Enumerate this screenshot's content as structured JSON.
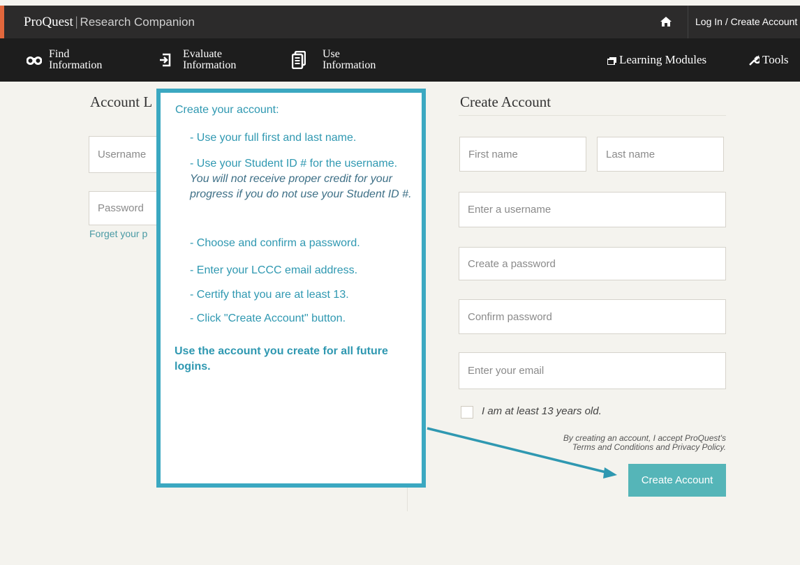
{
  "header": {
    "brand": "ProQuest",
    "brand_separator": "|",
    "product": "Research Companion",
    "login_label": "Log In / Create Account",
    "colors": {
      "accent_strip": "#e2673c",
      "top_bar": "#2c2b2b"
    }
  },
  "nav": {
    "items": [
      {
        "line1": "Find",
        "line2": "Information",
        "icon": "binoculars-icon"
      },
      {
        "line1": "Evaluate",
        "line2": "Information",
        "icon": "sign-in-icon"
      },
      {
        "line1": "Use",
        "line2": "Information",
        "icon": "document-icon"
      }
    ],
    "learning_modules_label": "Learning Modules",
    "tools_label": "Tools"
  },
  "login": {
    "title": "Account L",
    "username_placeholder": "Username",
    "password_placeholder": "Password",
    "forgot_label": "Forget your p"
  },
  "create": {
    "title": "Create Account",
    "first_name_placeholder": "First name",
    "last_name_placeholder": "Last name",
    "username_placeholder": "Enter a username",
    "password_placeholder": "Create a password",
    "confirm_placeholder": "Confirm password",
    "email_placeholder": "Enter your email",
    "age_label": "I am at least 13 years old.",
    "terms_line1": "By creating an account, I accept ProQuest's",
    "terms_line2": "Terms and Conditions and Privacy Policy.",
    "button_label": "Create Account",
    "button_color": "#55b5b8"
  },
  "callout": {
    "heading": "Create your account:",
    "item1": "- Use your full first and last name.",
    "item2a": "- Use your Student ID # for the username.",
    "item2b": "You will not receive proper credit for your progress if you do not use your Student ID #.",
    "item3": "- Choose and confirm a password.",
    "item4": "- Enter your LCCC email address.",
    "item5": "- Certify that you are at least 13.",
    "item6": "- Click \"Create Account\" button.",
    "note": "Use the account you create for all future logins.",
    "border_color": "#3ba8c1"
  }
}
